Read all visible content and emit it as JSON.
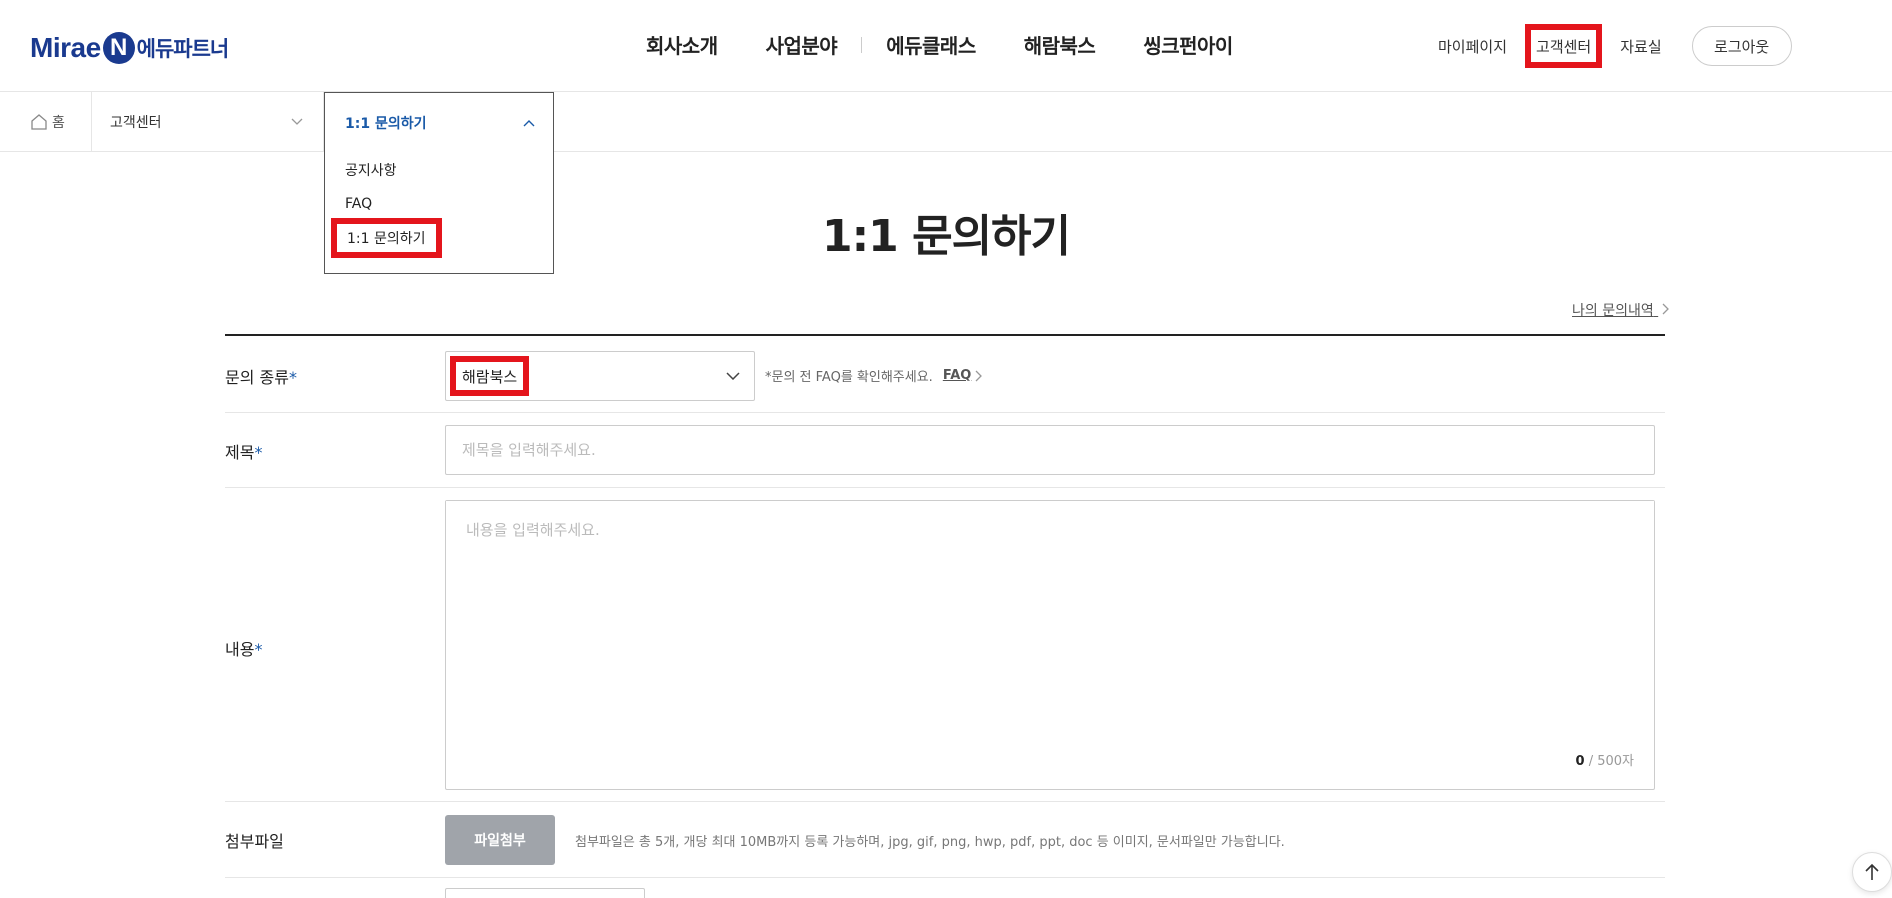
{
  "header": {
    "logo": {
      "brand": "Mirae",
      "n": "N",
      "kr": "에듀파트너"
    },
    "gnb": [
      "회사소개",
      "사업분야",
      "에듀클래스",
      "해람북스",
      "씽크펀아이"
    ],
    "util": {
      "mypage": "마이페이지",
      "cs": "고객센터",
      "data": "자료실",
      "logout": "로그아웃"
    }
  },
  "location": {
    "home": "홈",
    "depth1": "고객센터",
    "depth2": "1:1 문의하기",
    "depth2_options": [
      "공지사항",
      "FAQ",
      "1:1 문의하기"
    ]
  },
  "page": {
    "title": "1:1 문의하기",
    "my_inquiry": "나의 문의내역"
  },
  "form": {
    "type": {
      "label": "문의 종류",
      "value": "해람북스",
      "note": "*문의 전 FAQ를 확인해주세요.",
      "faq_link": "FAQ"
    },
    "subject": {
      "label": "제목",
      "placeholder": "제목을 입력해주세요."
    },
    "content": {
      "label": "내용",
      "placeholder": "내용을 입력해주세요.",
      "count": "0",
      "max": " / 500자"
    },
    "file": {
      "label": "첨부파일",
      "button": "파일첨부",
      "note": "첨부파일은 총 5개, 개당 최대 10MB까지 등록 가능하며, jpg, gif, png, hwp, pdf, ppt, doc 등 이미지, 문서파일만 가능합니다."
    },
    "required_mark": "*"
  },
  "colors": {
    "brand": "#1a3a8f",
    "accent": "#1a5aa8",
    "highlight": "#e4151c"
  }
}
